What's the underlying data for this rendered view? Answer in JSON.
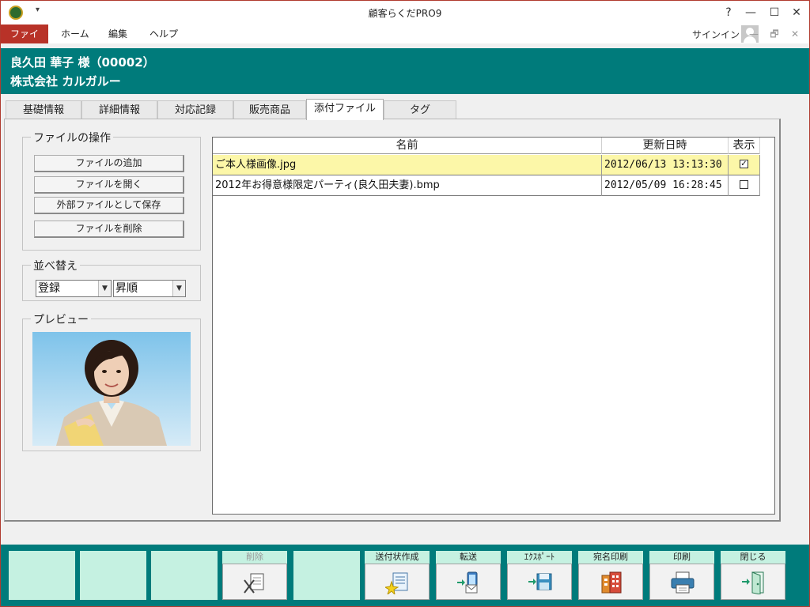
{
  "window": {
    "title": "顧客らくだPRO9",
    "help": "?",
    "minimize": "—",
    "maximize": "☐",
    "close": "✕"
  },
  "menu": {
    "items": [
      "ファイル",
      "ホーム",
      "編集",
      "ヘルプ"
    ],
    "signin": "サインイン",
    "ribbon_minimize": "—",
    "ribbon_restore": "🗗",
    "ribbon_close": "✕"
  },
  "customer": {
    "name_line": "良久田 華子 様（00002）",
    "company_line": "株式会社 カルガルー"
  },
  "tabs": [
    "基礎情報",
    "詳細情報",
    "対応記録",
    "販売商品",
    "添付ファイル",
    "タグ"
  ],
  "active_tab": 4,
  "file_ops": {
    "title": "ファイルの操作",
    "buttons": [
      "ファイルの追加",
      "ファイルを開く",
      "外部ファイルとして保存",
      "ファイルを削除"
    ]
  },
  "sort": {
    "title": "並べ替え",
    "field": "登録",
    "order": "昇順"
  },
  "preview": {
    "title": "プレビュー"
  },
  "file_table": {
    "columns": [
      "名前",
      "更新日時",
      "表示"
    ],
    "rows": [
      {
        "name": "ご本人様画像.jpg",
        "updated": "2012/06/13 13:13:30",
        "shown": true,
        "selected": true
      },
      {
        "name": "2012年お得意様限定パーティ(良久田夫妻).bmp",
        "updated": "2012/05/09 16:28:45",
        "shown": false,
        "selected": false
      }
    ]
  },
  "toolbar": {
    "buttons": [
      {
        "label": "",
        "icon": "empty"
      },
      {
        "label": "",
        "icon": "empty"
      },
      {
        "label": "",
        "icon": "empty"
      },
      {
        "label": "削除",
        "icon": "delete-icon",
        "disabled": true
      },
      {
        "label": "",
        "icon": "empty"
      },
      {
        "label": "送付状作成",
        "icon": "cover-letter-icon"
      },
      {
        "label": "転送",
        "icon": "transfer-icon"
      },
      {
        "label": "ｴｸｽﾎﾟｰﾄ",
        "icon": "export-icon"
      },
      {
        "label": "宛名印刷",
        "icon": "address-print-icon"
      },
      {
        "label": "印刷",
        "icon": "printer-icon"
      },
      {
        "label": "閉じる",
        "icon": "close-door-icon"
      }
    ]
  },
  "colors": {
    "teal": "#007b7b",
    "menu_active": "#b83228",
    "toolbar_button": "#c5f1e1",
    "selected_row": "#fcf7a8"
  }
}
